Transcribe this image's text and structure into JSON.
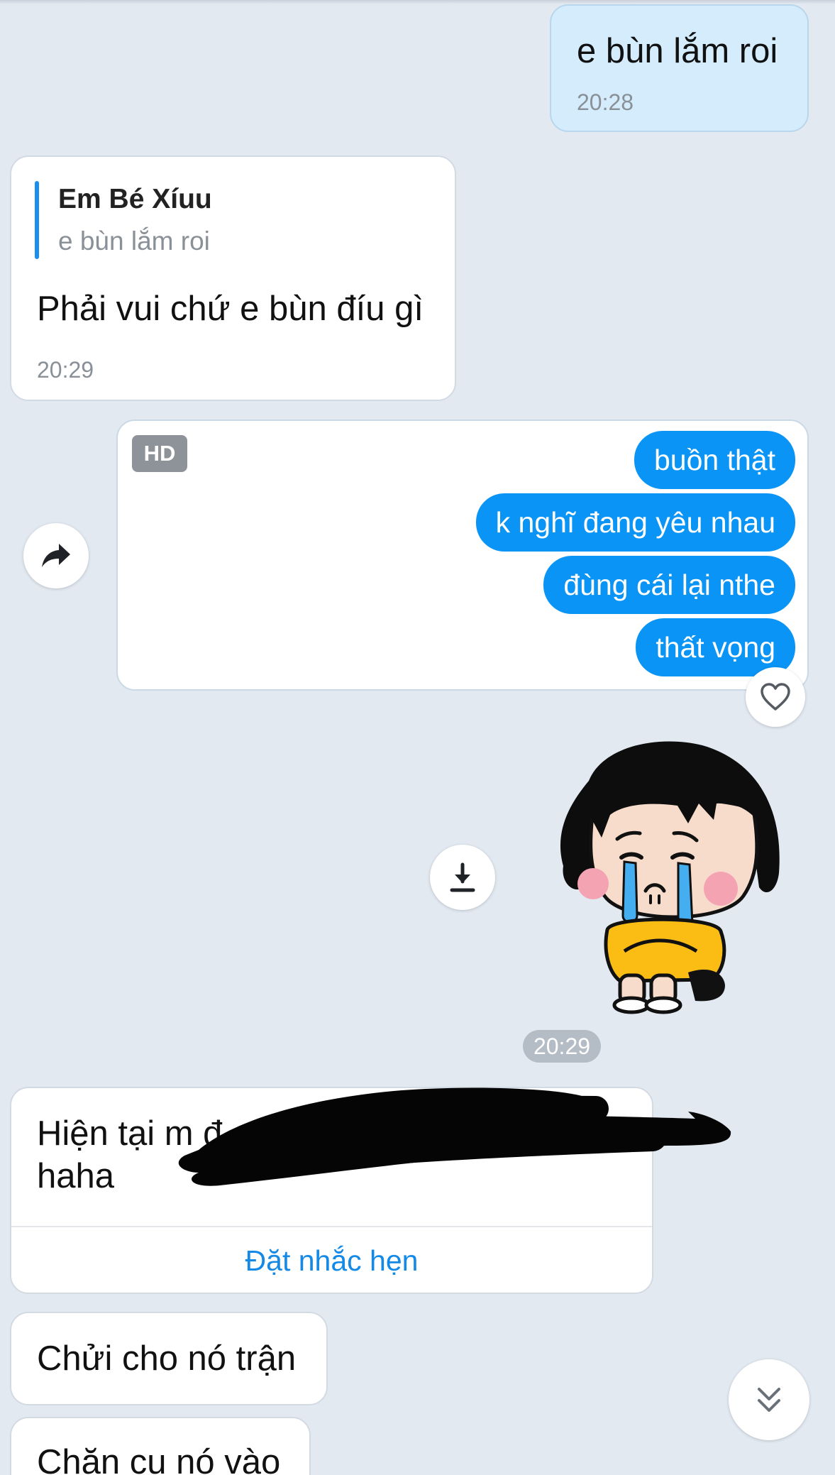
{
  "messages": {
    "m1": {
      "text": "e bùn lắm roi",
      "time": "20:28"
    },
    "m2": {
      "quote": {
        "name": "Em Bé Xíuu",
        "text": "e bùn lắm roi"
      },
      "text": "Phải vui chứ e bùn đíu gì",
      "time": "20:29"
    },
    "m3": {
      "badge": "HD",
      "lines": [
        "buồn thật",
        "k nghĩ đang yêu nhau",
        "đùng cái lại nthe",
        "thất vọng"
      ]
    },
    "sticker_time": "20:29",
    "m4": {
      "line1": "Hiện tại m đ",
      "line2": "haha",
      "action": "Đặt nhắc hẹn"
    },
    "m5": {
      "text": "Chửi cho nó trận"
    },
    "m6": {
      "text": "Chặn cụ nó vào"
    }
  },
  "icons": {
    "forward": "forward-arrow-icon",
    "heart": "heart-outline-icon",
    "download": "download-icon",
    "scroll_down": "double-chevron-down-icon",
    "sticker": "crying-girl-sticker"
  },
  "colors": {
    "background": "#e2e9f1",
    "my_bubble": "#d4ecfb",
    "blue_pill": "#0a94f5",
    "link": "#1589e6"
  }
}
